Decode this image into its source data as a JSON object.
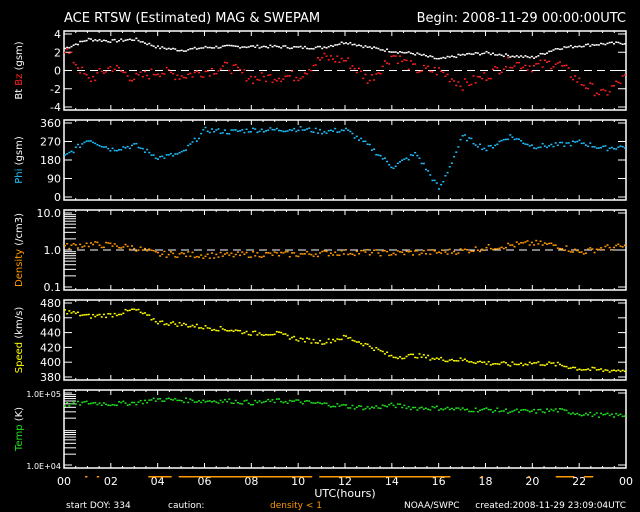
{
  "chart_data": {
    "type": "scatter",
    "title": "ACE RTSW (Estimated) MAG & SWEPAM",
    "begin": "Begin: 2008-11-29 00:00:00UTC",
    "xlabel": "UTC(hours)",
    "x_ticks": [
      "00",
      "02",
      "04",
      "06",
      "08",
      "10",
      "12",
      "14",
      "16",
      "18",
      "20",
      "22",
      "00"
    ],
    "xlim": [
      0,
      24
    ],
    "hours": [
      0,
      1,
      2,
      3,
      4,
      5,
      6,
      7,
      8,
      9,
      10,
      11,
      12,
      13,
      14,
      15,
      16,
      17,
      18,
      19,
      20,
      21,
      22,
      23,
      24
    ],
    "panels": [
      {
        "id": "mag",
        "ylabel_parts": [
          {
            "text": "Bt",
            "color": "#ffffff"
          },
          {
            "text": " Bz",
            "color": "#ff2020"
          },
          {
            "text": " (gsm)",
            "color": "#ffffff"
          }
        ],
        "scale": "linear",
        "ylim": [
          -4,
          4
        ],
        "yticks": [
          {
            "v": 4,
            "l": "4"
          },
          {
            "v": 2,
            "l": "2"
          },
          {
            "v": 0,
            "l": "0"
          },
          {
            "v": -2,
            "l": "-2"
          },
          {
            "v": -4,
            "l": "-4"
          }
        ],
        "refline": 0,
        "series": [
          {
            "name": "Bt",
            "color": "#ffffff",
            "spread": 0.15,
            "values": [
              2.5,
              3.5,
              3.3,
              3.5,
              2.6,
              2.3,
              2.6,
              2.7,
              2.7,
              2.7,
              2.6,
              2.6,
              3.2,
              2.6,
              2.2,
              1.9,
              1.3,
              1.8,
              2.0,
              1.7,
              1.5,
              2.5,
              2.8,
              3.0,
              3.1
            ]
          },
          {
            "name": "Bz",
            "color": "#ff2020",
            "spread": 0.6,
            "values": [
              2.5,
              -1.0,
              0.5,
              -0.8,
              0.0,
              -0.5,
              0.0,
              0.5,
              -0.8,
              -0.6,
              -0.5,
              1.5,
              1.2,
              -1.0,
              1.8,
              0.2,
              0.0,
              -1.5,
              -0.5,
              1.0,
              0.5,
              1.0,
              -1.2,
              -2.6,
              -0.5
            ]
          }
        ]
      },
      {
        "id": "phi",
        "ylabel_parts": [
          {
            "text": "Phi",
            "color": "#20c0ff"
          },
          {
            "text": " (gsm)",
            "color": "#ffffff"
          }
        ],
        "scale": "linear",
        "ylim": [
          0,
          360
        ],
        "yticks": [
          {
            "v": 360,
            "l": "360"
          },
          {
            "v": 270,
            "l": "270"
          },
          {
            "v": 180,
            "l": "180"
          },
          {
            "v": 90,
            "l": "90"
          },
          {
            "v": 0,
            "l": "0"
          }
        ],
        "series": [
          {
            "name": "Phi",
            "color": "#20c0ff",
            "spread": 12,
            "values": [
              200,
              285,
              235,
              255,
              195,
              215,
              330,
              320,
              330,
              330,
              335,
              322,
              330,
              250,
              150,
              215,
              40,
              300,
              235,
              300,
              250,
              255,
              270,
              240,
              250
            ]
          }
        ]
      },
      {
        "id": "density",
        "ylabel_parts": [
          {
            "text": "Density",
            "color": "#ff9900"
          },
          {
            "text": " (/cm3)",
            "color": "#ffffff"
          }
        ],
        "scale": "log",
        "ylim": [
          0.1,
          10
        ],
        "yticks": [
          {
            "v": 10,
            "l": "10.0"
          },
          {
            "v": 1,
            "l": "1.0"
          },
          {
            "v": 0.1,
            "l": "0.1"
          }
        ],
        "refline": 1,
        "series": [
          {
            "name": "Density",
            "color": "#ff9900",
            "spread": 0.08,
            "values": [
              1.3,
              1.5,
              1.4,
              1.2,
              0.8,
              0.8,
              0.75,
              0.75,
              0.8,
              0.8,
              0.8,
              0.85,
              0.9,
              0.9,
              0.85,
              0.9,
              0.9,
              1.0,
              1.2,
              1.4,
              1.6,
              1.4,
              0.9,
              1.2,
              1.3
            ]
          }
        ]
      },
      {
        "id": "speed",
        "ylabel_parts": [
          {
            "text": "Speed",
            "color": "#ffff00"
          },
          {
            "text": " (km/s)",
            "color": "#ffffff"
          }
        ],
        "scale": "linear",
        "ylim": [
          380,
          480
        ],
        "yticks": [
          {
            "v": 480,
            "l": "480"
          },
          {
            "v": 460,
            "l": "460"
          },
          {
            "v": 440,
            "l": "440"
          },
          {
            "v": 420,
            "l": "420"
          },
          {
            "v": 400,
            "l": "400"
          },
          {
            "v": 380,
            "l": "380"
          }
        ],
        "series": [
          {
            "name": "Speed",
            "color": "#ffff00",
            "spread": 3,
            "values": [
              470,
              463,
              465,
              472,
              455,
              452,
              448,
              445,
              440,
              440,
              432,
              428,
              435,
              423,
              408,
              410,
              405,
              404,
              400,
              398,
              400,
              398,
              392,
              390,
              390
            ]
          }
        ]
      },
      {
        "id": "temp",
        "ylabel_parts": [
          {
            "text": "Temp",
            "color": "#20e020"
          },
          {
            "text": " (K)",
            "color": "#ffffff"
          }
        ],
        "scale": "log",
        "ylim": [
          10000,
          1000000
        ],
        "yticks": [
          {
            "v": 1000000,
            "l": "1.0E+05"
          },
          {
            "v": 10000,
            "l": "1.0E+04"
          }
        ],
        "series": [
          {
            "name": "Temp",
            "color": "#20e020",
            "spread": 0.06,
            "values": [
              500000,
              560000,
              520000,
              560000,
              700000,
              660000,
              630000,
              630000,
              560000,
              630000,
              600000,
              520000,
              450000,
              400000,
              480000,
              400000,
              400000,
              360000,
              360000,
              330000,
              320000,
              350000,
              280000,
              250000,
              250000
            ]
          }
        ]
      }
    ],
    "caution_intervals": [
      [
        0.9,
        1.0
      ],
      [
        1.4,
        1.5
      ],
      [
        3.6,
        4.6
      ],
      [
        4.9,
        10.6
      ],
      [
        10.9,
        16.5
      ],
      [
        17.8,
        17.9
      ],
      [
        19.8,
        19.9
      ],
      [
        21.0,
        21.8
      ],
      [
        22.2,
        22.6
      ]
    ]
  },
  "footer": {
    "start_doy": "start DOY: 334",
    "caution": "caution:",
    "density_note": "density < 1",
    "source": "NOAA/SWPC",
    "created": "created:2008-11-29 23:09:04UTC"
  }
}
